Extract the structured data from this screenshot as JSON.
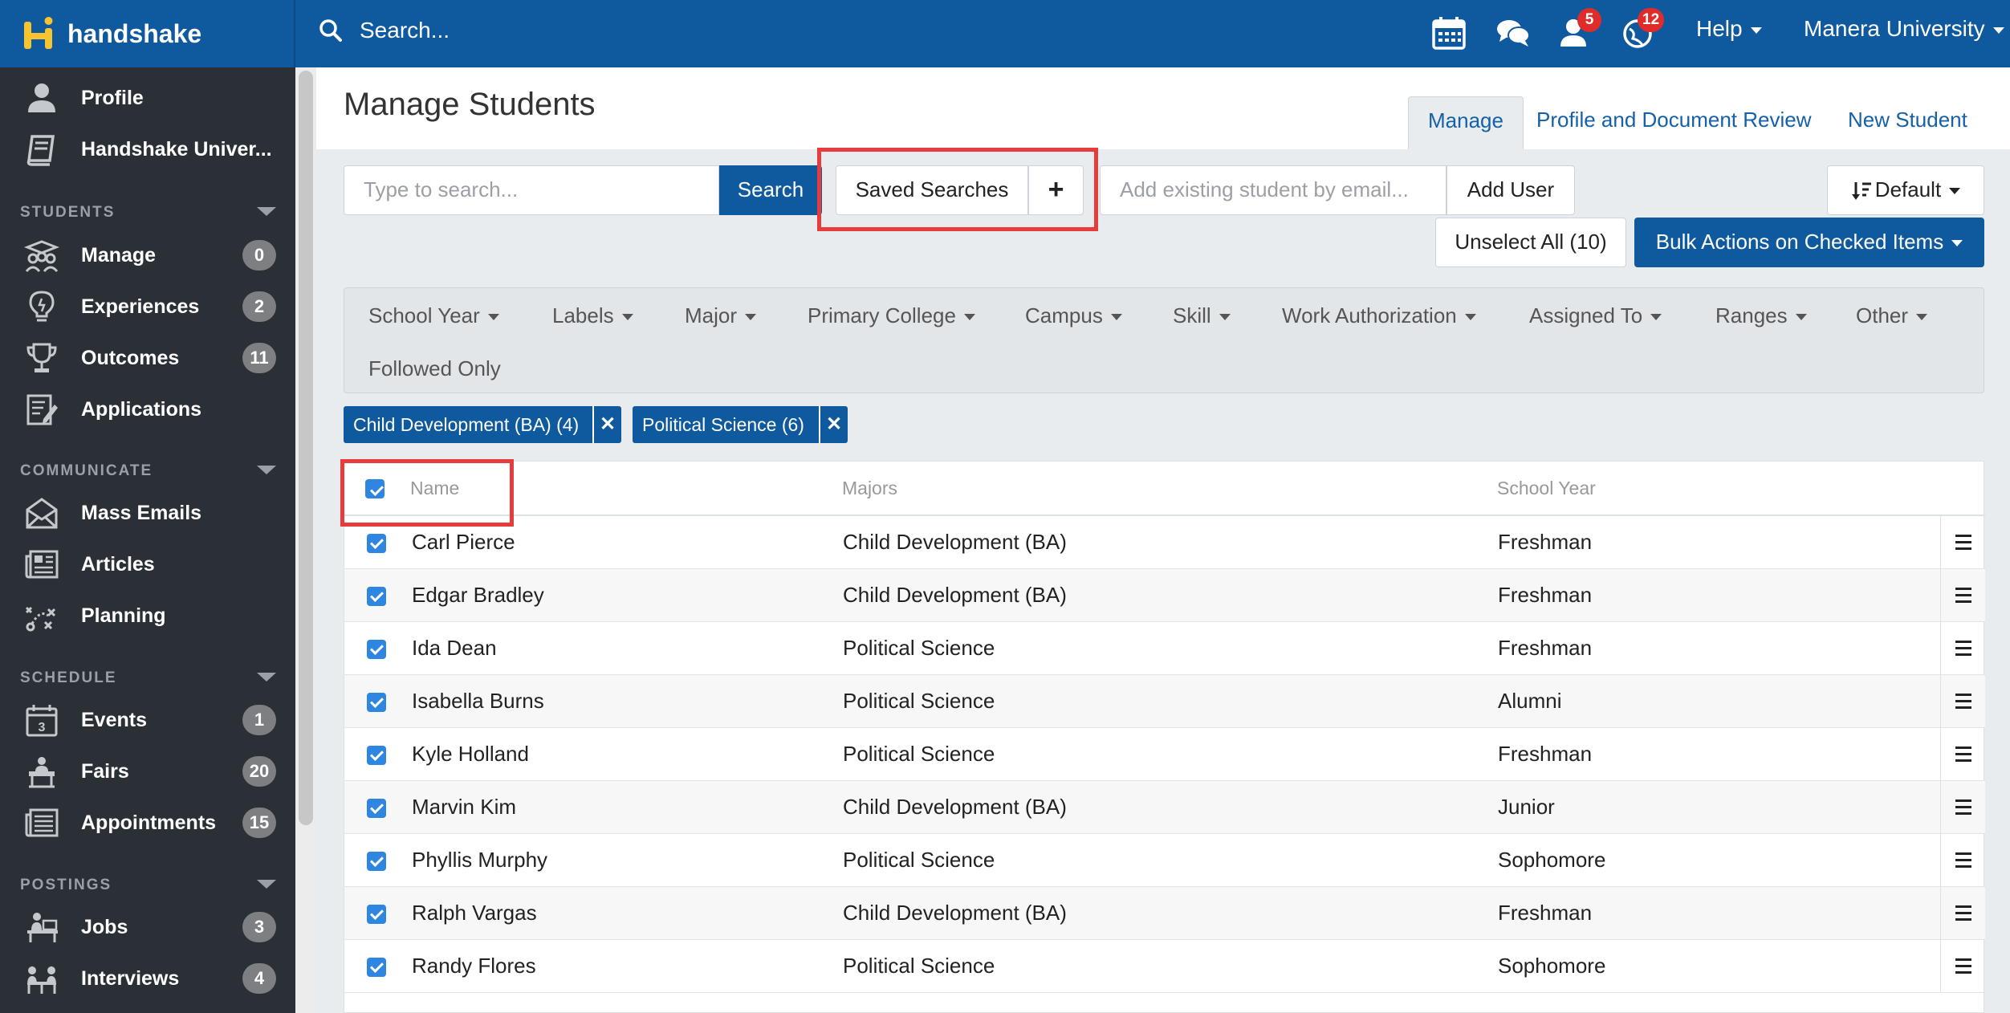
{
  "topbar": {
    "brand": "handshake",
    "search_placeholder": "Search...",
    "badges": {
      "notifications": "5",
      "alerts": "12"
    },
    "help_label": "Help",
    "account_label": "Manera University"
  },
  "sidebar": {
    "top_items": [
      {
        "label": "Profile"
      },
      {
        "label": "Handshake Univer..."
      }
    ],
    "sections": [
      {
        "title": "STUDENTS",
        "items": [
          {
            "label": "Manage",
            "count": "0"
          },
          {
            "label": "Experiences",
            "count": "2"
          },
          {
            "label": "Outcomes",
            "count": "11"
          },
          {
            "label": "Applications",
            "count": ""
          }
        ]
      },
      {
        "title": "COMMUNICATE",
        "items": [
          {
            "label": "Mass Emails",
            "count": ""
          },
          {
            "label": "Articles",
            "count": ""
          },
          {
            "label": "Planning",
            "count": ""
          }
        ]
      },
      {
        "title": "SCHEDULE",
        "items": [
          {
            "label": "Events",
            "count": "1"
          },
          {
            "label": "Fairs",
            "count": "20"
          },
          {
            "label": "Appointments",
            "count": "15"
          }
        ]
      },
      {
        "title": "POSTINGS",
        "items": [
          {
            "label": "Jobs",
            "count": "3"
          },
          {
            "label": "Interviews",
            "count": "4"
          }
        ]
      }
    ]
  },
  "main": {
    "title": "Manage Students",
    "tabs": [
      {
        "label": "Manage"
      },
      {
        "label": "Profile and Document Review"
      },
      {
        "label": "New Student"
      }
    ],
    "search_placeholder": "Type to search...",
    "search_button": "Search",
    "saved_searches": "Saved Searches",
    "add_search": "+",
    "email_placeholder": "Add existing student by email...",
    "add_user": "Add User",
    "sort_label": "Default",
    "unselect_all": "Unselect All (10)",
    "bulk_actions": "Bulk Actions on Checked Items",
    "filters": [
      "School Year",
      "Labels",
      "Major",
      "Primary College",
      "Campus",
      "Skill",
      "Work Authorization",
      "Assigned To",
      "Ranges",
      "Other"
    ],
    "followed_only": "Followed Only",
    "chips": [
      {
        "label": "Child Development (BA) (4)"
      },
      {
        "label": "Political Science (6)"
      }
    ],
    "table": {
      "headers": {
        "name": "Name",
        "majors": "Majors",
        "school_year": "School Year"
      },
      "rows": [
        {
          "name": "Carl Pierce",
          "major": "Child Development (BA)",
          "year": "Freshman"
        },
        {
          "name": "Edgar Bradley",
          "major": "Child Development (BA)",
          "year": "Freshman"
        },
        {
          "name": "Ida Dean",
          "major": "Political Science",
          "year": "Freshman"
        },
        {
          "name": "Isabella Burns",
          "major": "Political Science",
          "year": "Alumni"
        },
        {
          "name": "Kyle Holland",
          "major": "Political Science",
          "year": "Freshman"
        },
        {
          "name": "Marvin Kim",
          "major": "Child Development (BA)",
          "year": "Junior"
        },
        {
          "name": "Phyllis Murphy",
          "major": "Political Science",
          "year": "Sophomore"
        },
        {
          "name": "Ralph Vargas",
          "major": "Child Development (BA)",
          "year": "Freshman"
        },
        {
          "name": "Randy Flores",
          "major": "Political Science",
          "year": "Sophomore"
        }
      ]
    }
  },
  "colors": {
    "brand": "#0f5a9e",
    "sidebar": "#2a3036",
    "highlight": "#e63c3c",
    "checkbox": "#2f86e0"
  }
}
